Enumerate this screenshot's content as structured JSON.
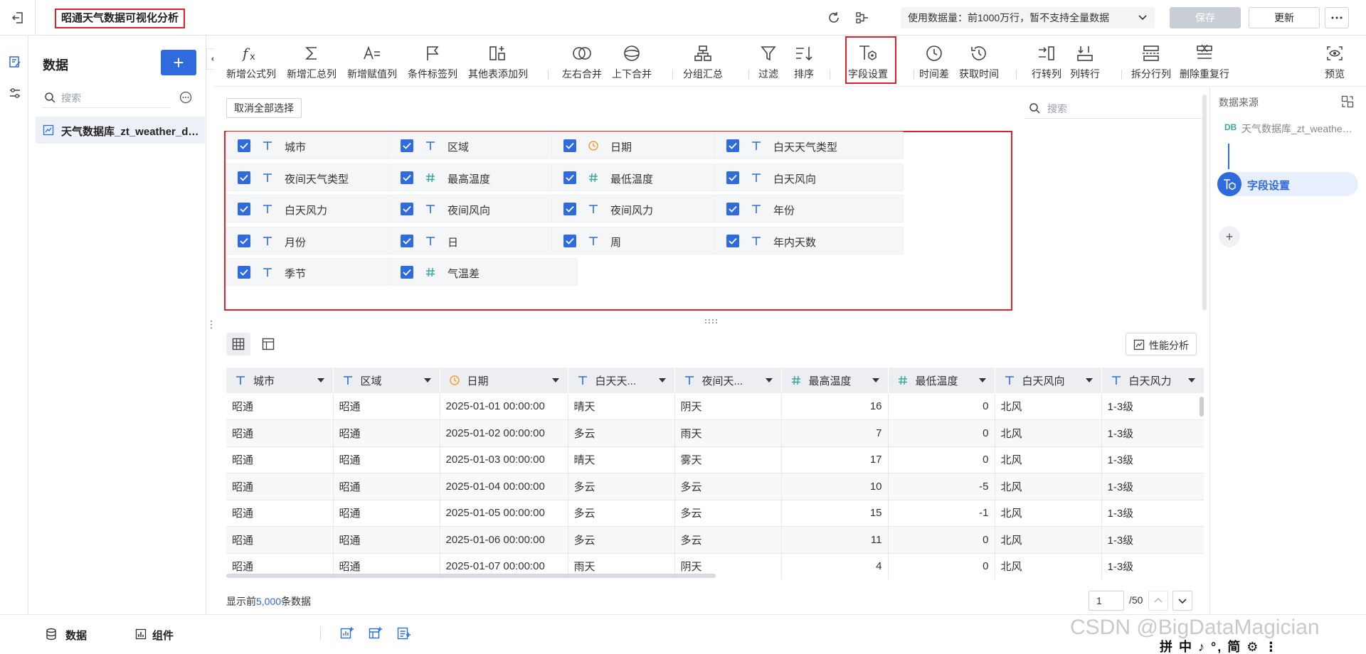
{
  "header": {
    "title": "昭通天气数据可视化分析",
    "usage_label": "使用数据量：前1000万行，暂不支持全量数据",
    "save_label": "保存",
    "update_label": "更新"
  },
  "data_panel": {
    "title": "数据",
    "search_placeholder": "搜索",
    "datasets": [
      {
        "label": "天气数据库_zt_weather_data"
      }
    ]
  },
  "toolbar": {
    "items": [
      {
        "label": "新增公式列",
        "icon": "formula-icon"
      },
      {
        "label": "新增汇总列",
        "icon": "sigma-icon"
      },
      {
        "label": "新增赋值列",
        "icon": "assign-icon"
      },
      {
        "label": "条件标签列",
        "icon": "flag-icon"
      },
      {
        "label": "其他表添加列",
        "icon": "add-column-icon"
      },
      {
        "label": "左右合并",
        "icon": "merge-lr-icon"
      },
      {
        "label": "上下合并",
        "icon": "merge-tb-icon"
      },
      {
        "label": "分组汇总",
        "icon": "group-icon"
      },
      {
        "label": "过滤",
        "icon": "filter-icon"
      },
      {
        "label": "排序",
        "icon": "sort-icon"
      },
      {
        "label": "字段设置",
        "icon": "field-settings-icon"
      },
      {
        "label": "时间差",
        "icon": "clock-icon"
      },
      {
        "label": "获取时间",
        "icon": "history-icon"
      },
      {
        "label": "行转列",
        "icon": "row-to-col-icon"
      },
      {
        "label": "列转行",
        "icon": "col-to-row-icon"
      },
      {
        "label": "拆分行列",
        "icon": "split-icon"
      },
      {
        "label": "删除重复行",
        "icon": "dedupe-icon"
      },
      {
        "label": "预览",
        "icon": "preview-icon"
      }
    ]
  },
  "fields": {
    "deselect_label": "取消全部选择",
    "search_placeholder": "搜索",
    "items": [
      {
        "label": "城市",
        "type": "text"
      },
      {
        "label": "区域",
        "type": "text"
      },
      {
        "label": "日期",
        "type": "date"
      },
      {
        "label": "白天天气类型",
        "type": "text"
      },
      {
        "label": "夜间天气类型",
        "type": "text"
      },
      {
        "label": "最高温度",
        "type": "number"
      },
      {
        "label": "最低温度",
        "type": "number"
      },
      {
        "label": "白天风向",
        "type": "text"
      },
      {
        "label": "白天风力",
        "type": "text"
      },
      {
        "label": "夜间风向",
        "type": "text"
      },
      {
        "label": "夜间风力",
        "type": "text"
      },
      {
        "label": "年份",
        "type": "text"
      },
      {
        "label": "月份",
        "type": "text"
      },
      {
        "label": "日",
        "type": "text"
      },
      {
        "label": "周",
        "type": "text"
      },
      {
        "label": "年内天数",
        "type": "text"
      },
      {
        "label": "季节",
        "type": "text"
      },
      {
        "label": "气温差",
        "type": "number"
      }
    ]
  },
  "preview": {
    "perf_label": "性能分析",
    "columns": [
      {
        "label": "城市",
        "type": "text"
      },
      {
        "label": "区域",
        "type": "text"
      },
      {
        "label": "日期",
        "type": "date"
      },
      {
        "label": "白天天...",
        "type": "text"
      },
      {
        "label": "夜间天...",
        "type": "text"
      },
      {
        "label": "最高温度",
        "type": "number"
      },
      {
        "label": "最低温度",
        "type": "number"
      },
      {
        "label": "白天风向",
        "type": "text"
      },
      {
        "label": "白天风力",
        "type": "text"
      }
    ],
    "rows": [
      [
        "昭通",
        "昭通",
        "2025-01-01 00:00:00",
        "晴天",
        "阴天",
        "16",
        "0",
        "北风",
        "1-3级"
      ],
      [
        "昭通",
        "昭通",
        "2025-01-02 00:00:00",
        "多云",
        "雨天",
        "7",
        "0",
        "北风",
        "1-3级"
      ],
      [
        "昭通",
        "昭通",
        "2025-01-03 00:00:00",
        "晴天",
        "雾天",
        "17",
        "0",
        "北风",
        "1-3级"
      ],
      [
        "昭通",
        "昭通",
        "2025-01-04 00:00:00",
        "多云",
        "多云",
        "10",
        "-5",
        "北风",
        "1-3级"
      ],
      [
        "昭通",
        "昭通",
        "2025-01-05 00:00:00",
        "多云",
        "多云",
        "15",
        "-1",
        "北风",
        "1-3级"
      ],
      [
        "昭通",
        "昭通",
        "2025-01-06 00:00:00",
        "多云",
        "多云",
        "11",
        "0",
        "北风",
        "1-3级"
      ],
      [
        "昭通",
        "昭通",
        "2025-01-07 00:00:00",
        "雨天",
        "阴天",
        "4",
        "0",
        "北风",
        "1-3级"
      ]
    ],
    "row_count_prefix": "显示前",
    "row_count_value": "5,000",
    "row_count_suffix": "条数据",
    "page_current": "1",
    "page_total": "/50"
  },
  "flow": {
    "title": "数据来源",
    "source_tag": "DB",
    "source_label": "天气数据库_zt_weather_data",
    "node_label": "字段设置"
  },
  "bottom": {
    "data_tab": "数据",
    "component_tab": "组件"
  },
  "watermark": "CSDN @BigDataMagician",
  "ime": "拼 中 ♪ °, 简 ⚙ ⋮",
  "colors": {
    "accent": "#2f6bdc",
    "highlight_border": "#d9232d",
    "date_icon": "#f0a030",
    "number_icon": "#3aa89a"
  }
}
